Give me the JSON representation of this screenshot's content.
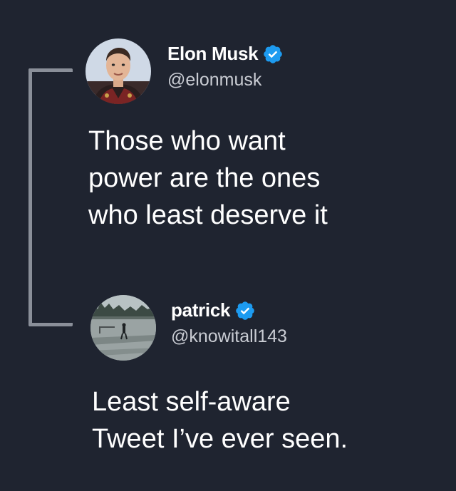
{
  "colors": {
    "background": "#1f2430",
    "thread_line": "#8a8f99",
    "verified_badge": "#1d9bf0",
    "text_primary": "#ffffff",
    "text_secondary": "#c9ccd3"
  },
  "tweets": [
    {
      "display_name": "Elon Musk",
      "handle": "@elonmusk",
      "verified": true,
      "avatar_icon": "person-portrait-avatar",
      "text": "Those who want\npower are the ones\nwho least deserve it"
    },
    {
      "display_name": "patrick",
      "handle": "@knowitall143",
      "verified": true,
      "avatar_icon": "landscape-figure-avatar",
      "text": "Least self-aware\nTweet I’ve ever seen."
    }
  ]
}
